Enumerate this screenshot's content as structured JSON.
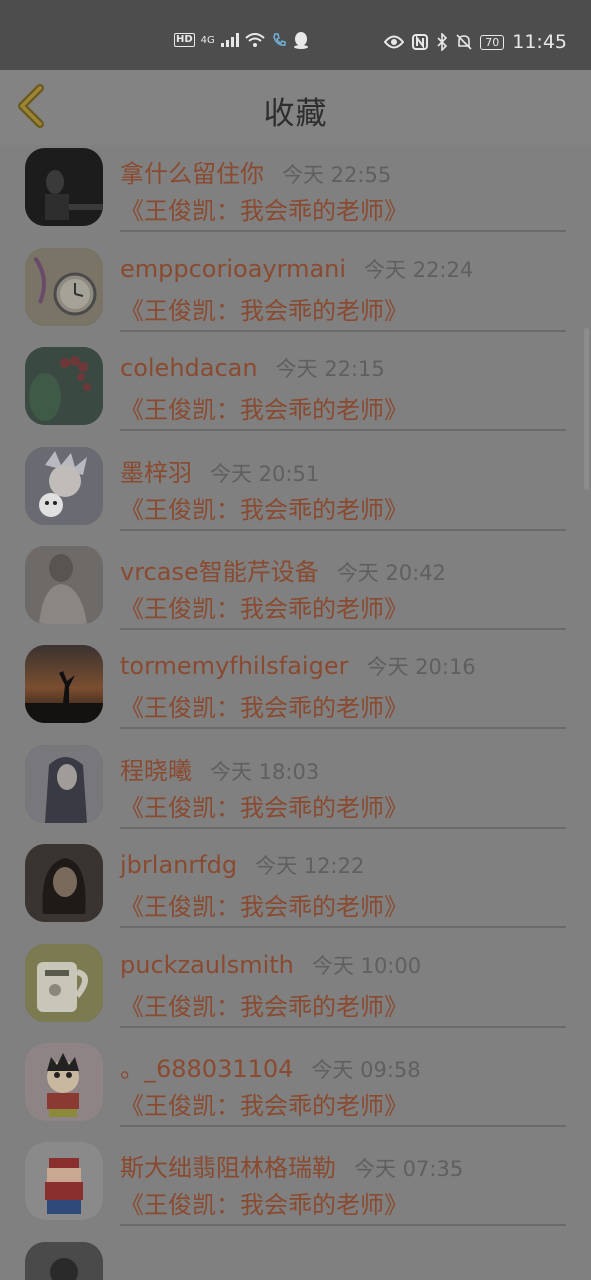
{
  "status_bar": {
    "left_badge": "HD",
    "network": "4G",
    "battery": "70",
    "time": "11:45",
    "icons": [
      "signal-icon",
      "wifi-icon",
      "phone-icon",
      "qq-icon",
      "eye-icon",
      "nfc-icon",
      "bluetooth-icon",
      "mute-icon"
    ]
  },
  "header": {
    "title": "收藏",
    "back_icon": "chevron-left-icon"
  },
  "colors": {
    "accent": "#8a4a30",
    "time": "#5f5f5f",
    "header_bg": "#838383",
    "body_bg": "#808080"
  },
  "favorites": [
    {
      "name": "",
      "time": "",
      "subject": ""
    },
    {
      "name": "拿什么留住你",
      "time": "今天 22:55",
      "subject": "《王俊凯：我会乖的老师》"
    },
    {
      "name": "emppcorioayrmani",
      "time": "今天 22:24",
      "subject": "《王俊凯：我会乖的老师》"
    },
    {
      "name": "colehdacan",
      "time": "今天 22:15",
      "subject": "《王俊凯：我会乖的老师》"
    },
    {
      "name": "墨梓羽",
      "time": "今天 20:51",
      "subject": "《王俊凯：我会乖的老师》"
    },
    {
      "name": "vrcase智能芹设备",
      "time": "今天 20:42",
      "subject": "《王俊凯：我会乖的老师》"
    },
    {
      "name": "tormemyfhilsfaiger",
      "time": "今天 20:16",
      "subject": "《王俊凯：我会乖的老师》"
    },
    {
      "name": "程晓曦",
      "time": "今天 18:03",
      "subject": "《王俊凯：我会乖的老师》"
    },
    {
      "name": "jbrlanrfdg",
      "time": "今天 12:22",
      "subject": "《王俊凯：我会乖的老师》"
    },
    {
      "name": "puckzaulsmith",
      "time": "今天 10:00",
      "subject": "《王俊凯：我会乖的老师》"
    },
    {
      "name": "。_688031104",
      "time": "今天 09:58",
      "subject": "《王俊凯：我会乖的老师》"
    },
    {
      "name": "斯大绌翡阻林格瑞勒",
      "time": "今天 07:35",
      "subject": "《王俊凯：我会乖的老师》"
    },
    {
      "name": "",
      "time": "",
      "subject": ""
    }
  ]
}
